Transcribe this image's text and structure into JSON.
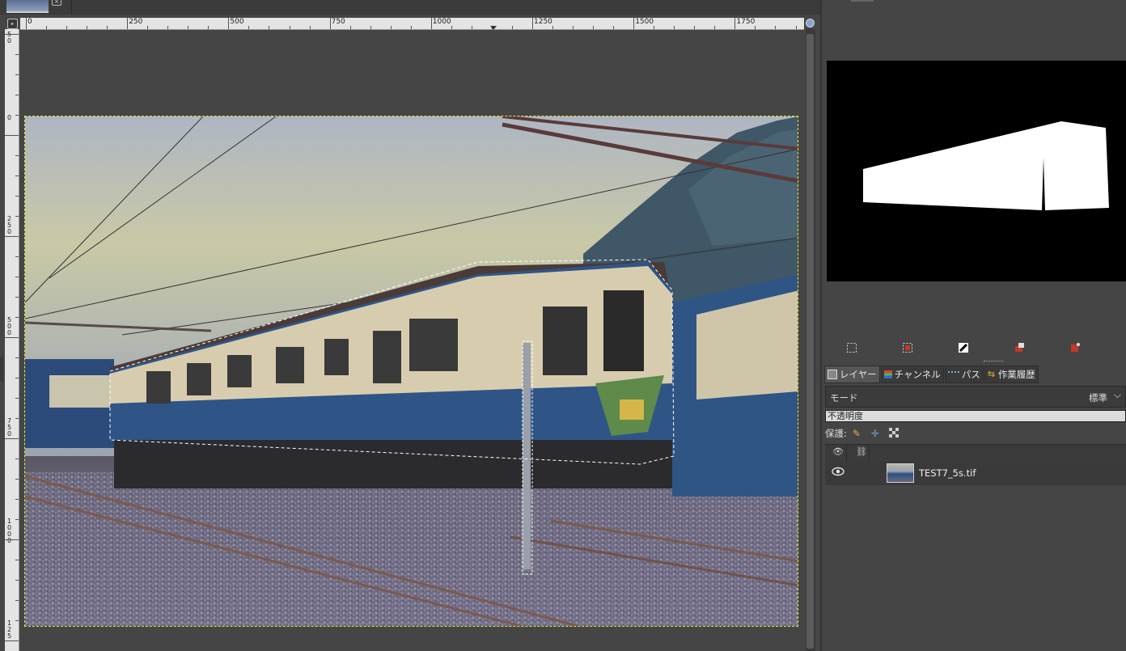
{
  "tabbar": {
    "close_glyph": "×"
  },
  "ruler": {
    "corner_glyph": "▸",
    "h_labels": [
      "0",
      "250",
      "500",
      "750",
      "1000",
      "1250",
      "1500",
      "1750"
    ],
    "v_labels": [
      "5\n0",
      "0",
      "2\n5\n0",
      "5\n0\n0",
      "7\n5\n0",
      "1\n0\n0\n0",
      "1\n2\n5"
    ]
  },
  "preview_toolbar": {
    "icons": [
      "select-rect-icon",
      "select-fg-icon",
      "select-invert-icon",
      "select-to-channel-icon",
      "select-clear-icon"
    ]
  },
  "dock": {
    "tabs": [
      {
        "label": "レイヤー",
        "icon": "layers-icon",
        "active": true
      },
      {
        "label": "チャンネル",
        "icon": "channels-icon",
        "active": false
      },
      {
        "label": "パス",
        "icon": "paths-icon",
        "active": false
      },
      {
        "label": "作業履歴",
        "icon": "undo-history-icon",
        "active": false
      }
    ],
    "mode_label": "モード",
    "mode_value": "標準",
    "opacity_label": "不透明度",
    "lock_label": "保護:",
    "lock_icons": [
      "lock-pixels-icon",
      "lock-position-icon",
      "lock-alpha-icon"
    ]
  },
  "layers": [
    {
      "name": "TEST7_5s.tif",
      "visible": true
    }
  ],
  "colors": {
    "selection_border": "#e9e53a",
    "preview_bg": "#000000",
    "selection_fill": "#ffffff"
  }
}
